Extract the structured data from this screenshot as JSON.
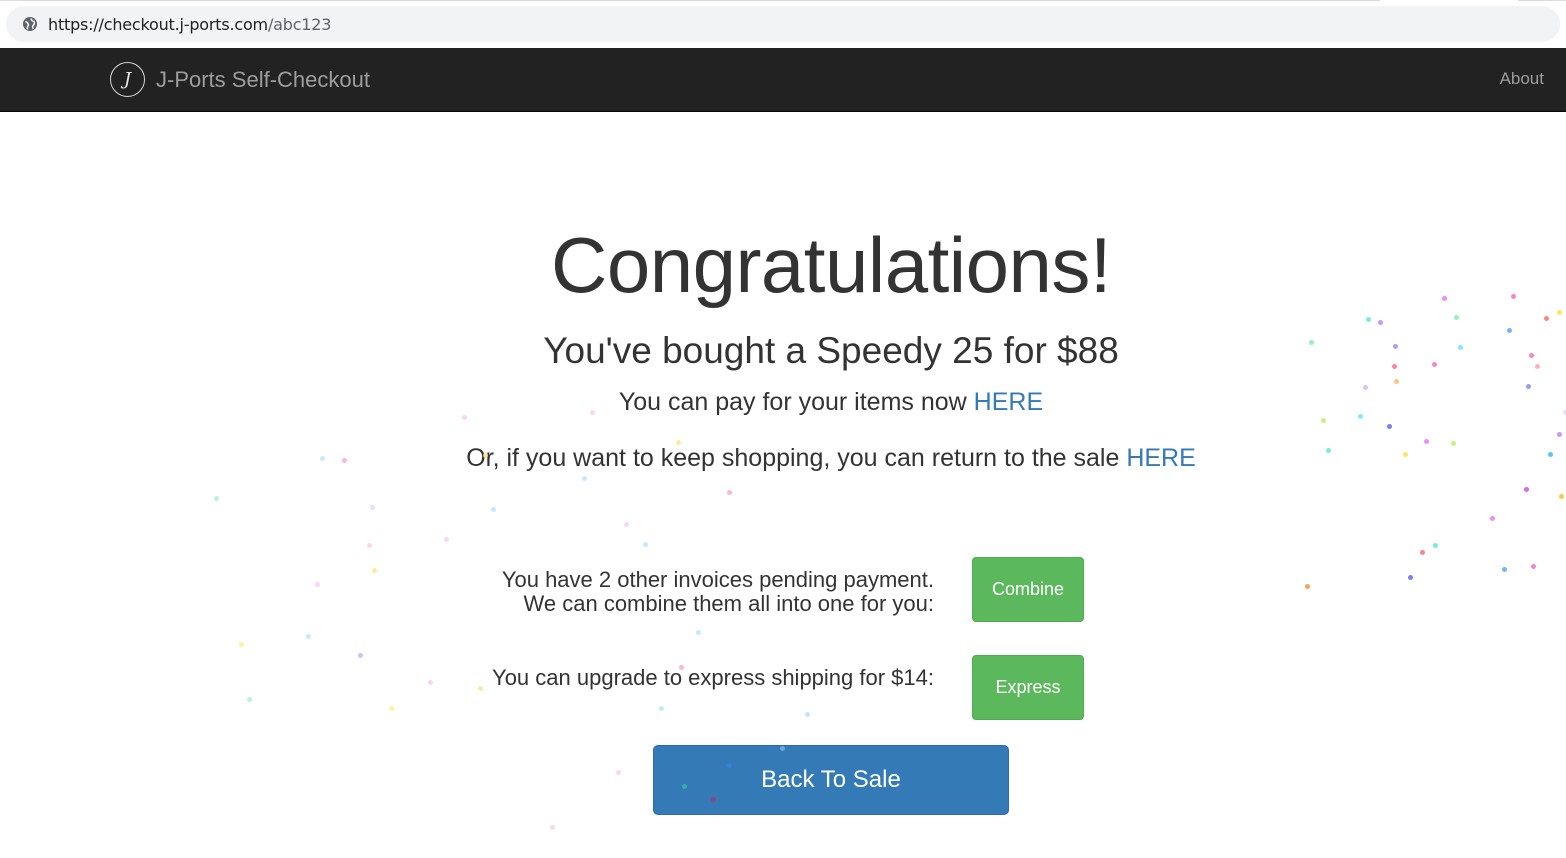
{
  "browser": {
    "url_host": "https://checkout.j-ports.com",
    "url_path": "/abc123",
    "site_icon": "globe-icon"
  },
  "navbar": {
    "logo_letter": "J",
    "brand": "J-Ports Self-Checkout",
    "about": "About"
  },
  "main": {
    "title": "Congratulations!",
    "subtitle": "You've bought a Speedy 25 for $88",
    "pay_prefix": "You can pay for your items now ",
    "pay_link": "HERE",
    "return_prefix": "Or, if you want to keep shopping, you can return to the sale ",
    "return_link": "HERE"
  },
  "offers": {
    "combine_line1": "You have 2 other invoices pending payment.",
    "combine_line2": "We can combine them all into one for you:",
    "combine_button": "Combine",
    "express_text": "You can upgrade to express shipping for $14:",
    "express_button": "Express"
  },
  "back_button": "Back To Sale",
  "colors": {
    "navbar_bg": "#222222",
    "link": "#337ab7",
    "success": "#5cb85c",
    "primary": "#337ab7"
  }
}
